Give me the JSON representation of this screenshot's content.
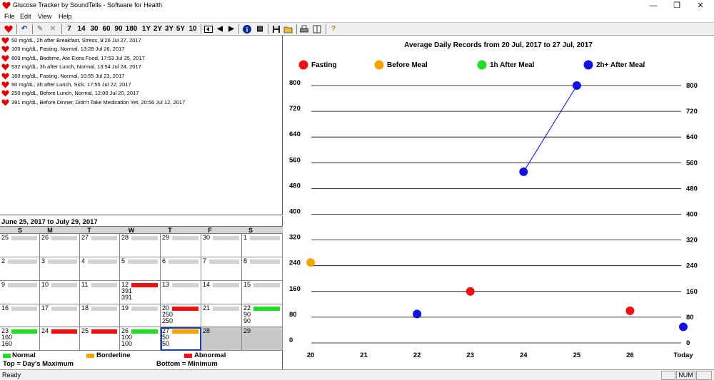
{
  "window": {
    "title": "Glucose Tracker by SoundTells - Software for Health",
    "minimize": "—",
    "maximize": "❐",
    "close": "✕"
  },
  "menu": [
    "File",
    "Edit",
    "View",
    "Help"
  ],
  "toolbar": {
    "range_buttons": [
      "7",
      "14",
      "30",
      "60",
      "90",
      "180",
      "1Y",
      "2Y",
      "3Y",
      "5Y",
      "10"
    ],
    "prev_arrow": "◀",
    "next_arrow": "▶",
    "info": "i",
    "help": "?"
  },
  "records": [
    "50 mg/dL, 2h after Breakfast, Stress, 9:26 Jul 27, 2017",
    "100 mg/dL, Fasting, Normal, 13:28 Jul 26, 2017",
    "800 mg/dL, Bedtime, Ate Extra Food, 17:53 Jul 25, 2017",
    "532 mg/dL, 3h after Lunch, Normal, 13:54 Jul 24, 2017",
    "160 mg/dL, Fasting, Normal, 10:55 Jul 23, 2017",
    "90 mg/dL, 3h after Lunch, Sick, 17:55 Jul 22, 2017",
    "250 mg/dL, Before Lunch, Normal, 12:00 Jul 20, 2017",
    "391 mg/dL, Before Dinner, Didn't Take Medication Yet, 20:56 Jul 12, 2017"
  ],
  "calendar": {
    "range": "June 25, 2017 to July 29, 2017",
    "days_of_week": [
      "S",
      "M",
      "T",
      "W",
      "T",
      "F",
      "S"
    ],
    "weeks": [
      [
        {
          "day": "25",
          "bar": "none"
        },
        {
          "day": "26",
          "bar": "none"
        },
        {
          "day": "27",
          "bar": "none"
        },
        {
          "day": "28",
          "bar": "none"
        },
        {
          "day": "29",
          "bar": "none"
        },
        {
          "day": "30",
          "bar": "none"
        },
        {
          "day": "1",
          "bar": "none"
        }
      ],
      [
        {
          "day": "2",
          "bar": "none"
        },
        {
          "day": "3",
          "bar": "none"
        },
        {
          "day": "4",
          "bar": "none"
        },
        {
          "day": "5",
          "bar": "none"
        },
        {
          "day": "6",
          "bar": "none"
        },
        {
          "day": "7",
          "bar": "none"
        },
        {
          "day": "8",
          "bar": "none"
        }
      ],
      [
        {
          "day": "9",
          "bar": "none"
        },
        {
          "day": "10",
          "bar": "none"
        },
        {
          "day": "11",
          "bar": "none"
        },
        {
          "day": "12",
          "bar": "abnormal",
          "max": "391",
          "min": "391"
        },
        {
          "day": "13",
          "bar": "none"
        },
        {
          "day": "14",
          "bar": "none"
        },
        {
          "day": "15",
          "bar": "none"
        }
      ],
      [
        {
          "day": "16",
          "bar": "none"
        },
        {
          "day": "17",
          "bar": "none"
        },
        {
          "day": "18",
          "bar": "none"
        },
        {
          "day": "19",
          "bar": "none"
        },
        {
          "day": "20",
          "bar": "abnormal",
          "max": "250",
          "min": "250"
        },
        {
          "day": "21",
          "bar": "none"
        },
        {
          "day": "22",
          "bar": "normal",
          "max": "90",
          "min": "90"
        }
      ],
      [
        {
          "day": "23",
          "bar": "normal",
          "max": "160",
          "min": "160"
        },
        {
          "day": "24",
          "bar": "abnormal"
        },
        {
          "day": "25",
          "bar": "abnormal"
        },
        {
          "day": "26",
          "bar": "normal",
          "max": "100",
          "min": "100"
        },
        {
          "day": "27",
          "bar": "borderline",
          "max": "50",
          "min": "50",
          "selected": true
        },
        {
          "day": "28",
          "bar": "empty",
          "grey": true
        },
        {
          "day": "29",
          "bar": "empty",
          "grey": true
        }
      ]
    ],
    "legend": {
      "normal": "Normal",
      "borderline": "Borderline",
      "abnormal": "Abnormal",
      "top_note": "Top = Day's Maximum",
      "bottom_note": "Bottom = Minimum"
    }
  },
  "colors": {
    "normal": "#22dd22",
    "borderline": "#f5a300",
    "abnormal": "#ee1111",
    "empty_bar": "#d2d2d2",
    "fasting": "#ee1111",
    "before_meal": "#f5a300",
    "after_1h": "#22dd22",
    "after_2h": "#1010e0"
  },
  "chart_data": {
    "type": "scatter",
    "title": "Average Daily Records from 20 Jul, 2017 to 27 Jul, 2017",
    "categories": [
      "20",
      "21",
      "22",
      "23",
      "24",
      "25",
      "26",
      "Today"
    ],
    "ylim": [
      0,
      800
    ],
    "yticks": [
      0,
      80,
      160,
      240,
      320,
      400,
      480,
      560,
      640,
      720,
      800
    ],
    "grid": true,
    "legend_position": "top",
    "series": [
      {
        "name": "Fasting",
        "color": "#ee1111",
        "points": [
          {
            "x": "23",
            "y": 160
          },
          {
            "x": "26",
            "y": 100
          }
        ],
        "line": false
      },
      {
        "name": "Before Meal",
        "color": "#f5a300",
        "points": [
          {
            "x": "20",
            "y": 250
          }
        ],
        "line": false
      },
      {
        "name": "1h After Meal",
        "color": "#22dd22",
        "points": [],
        "line": false
      },
      {
        "name": "2h+ After Meal",
        "color": "#1010e0",
        "points": [
          {
            "x": "22",
            "y": 90
          },
          {
            "x": "24",
            "y": 532
          },
          {
            "x": "25",
            "y": 800
          },
          {
            "x": "Today",
            "y": 50
          }
        ],
        "line_segments": [
          [
            "24",
            "25"
          ]
        ]
      }
    ]
  },
  "status": {
    "text": "Ready",
    "num": "NUM"
  }
}
